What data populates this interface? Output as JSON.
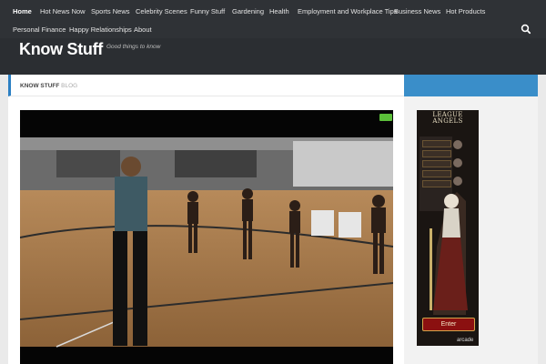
{
  "nav": {
    "row1": [
      "Home",
      "Hot News Now",
      "Sports News",
      "Celebrity Scenes",
      "Funny Stuff",
      "Gardening",
      "Health",
      "Employment and Workplace Tips",
      "Business News",
      "Hot Products"
    ],
    "row2": [
      "Personal Finance",
      "Happy Relationships",
      "About"
    ],
    "active": "Home"
  },
  "site": {
    "title": "Know Stuff",
    "tagline": "Good things to know"
  },
  "breadcrumb": {
    "strong": "KNOW STUFF",
    "light": "BLOG"
  },
  "video": {
    "badge": ""
  },
  "ad": {
    "logo": "LEAGUE ANGELS",
    "menu_rows": [
      "",
      "",
      "",
      "",
      ""
    ],
    "button": "Enter",
    "footer": "arcade"
  },
  "colors": {
    "nav_bg": "#2f3236",
    "header_bg": "#2b2e32",
    "accent": "#3a8ec9",
    "active_border": "#2b7fc3"
  },
  "icons": {
    "search": "search-icon"
  }
}
